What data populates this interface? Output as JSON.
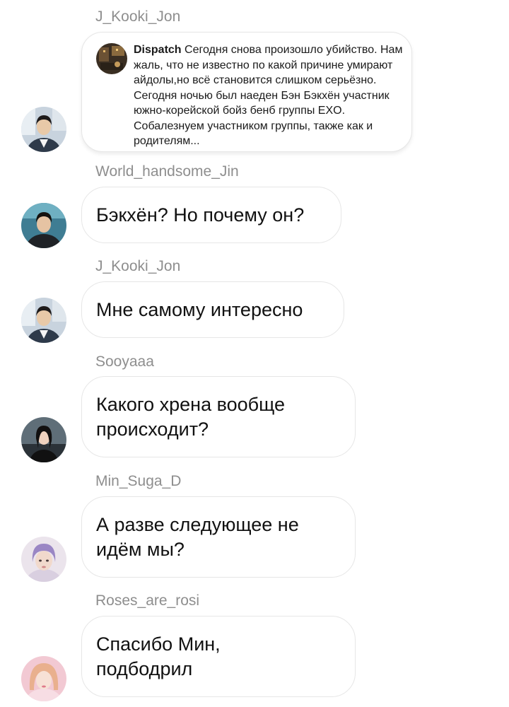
{
  "messages": [
    {
      "username": "J_Kooki_Jon",
      "type": "shared_post",
      "post_author": "Dispatch",
      "post_text": "Сегодня снова произошло убийство. Нам жаль, что не известно по какой причине умирают айдолы,но всё становится слишком серьёзно. Сегодня ночью был наеден Бэн Бэкхён участник южно-корейской бойз бенб группы EXO. Собалезнуем участником группы, также как и родителям..."
    },
    {
      "username": "World_handsome_Jin",
      "type": "text",
      "text": "Бэкхён? Но почему он?"
    },
    {
      "username": "J_Kooki_Jon",
      "type": "text",
      "text": "Мне самому интересно"
    },
    {
      "username": "Sooyaaa",
      "type": "text",
      "text": "Какого хрена вообще\nпроисходит?"
    },
    {
      "username": "Min_Suga_D",
      "type": "text",
      "text": "А разве следующее не\nидём мы?"
    },
    {
      "username": "Roses_are_rosi",
      "type": "text",
      "text": "Спасибо Мин,\nподбодрил"
    }
  ],
  "colors": {
    "username": "#8e8e8e",
    "bubble_border": "#e6e6e6",
    "text": "#111111"
  }
}
